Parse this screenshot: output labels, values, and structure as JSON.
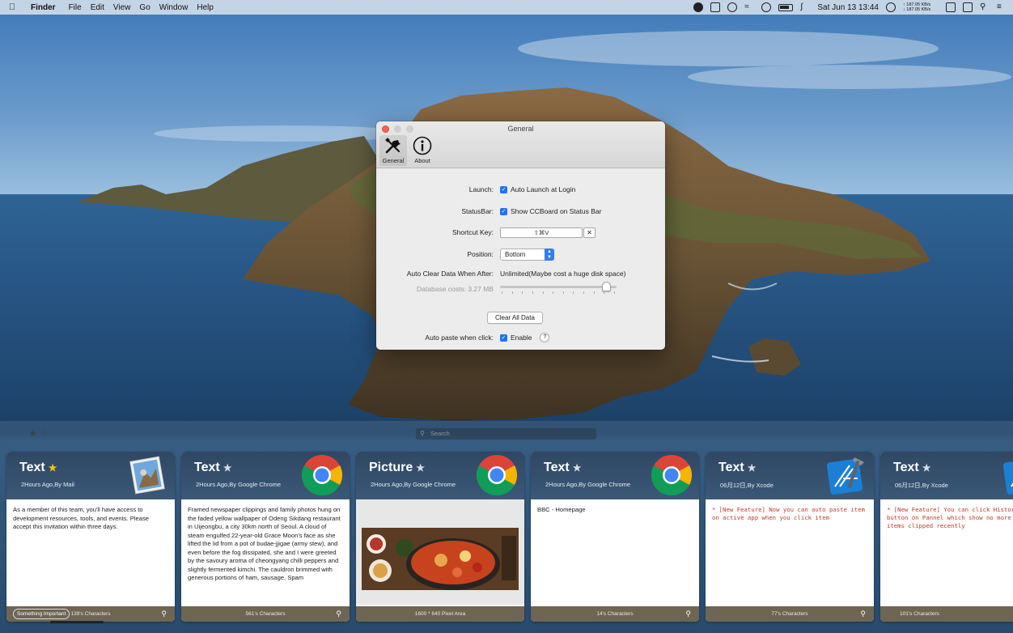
{
  "menubar": {
    "app": "Finder",
    "items": [
      "File",
      "Edit",
      "View",
      "Go",
      "Window",
      "Help"
    ],
    "clock": "Sat Jun 13  13:44",
    "netspeed_up": "↑ 187.05 KB/s",
    "netspeed_down": "↓ 187.05 KB/s"
  },
  "window": {
    "title": "General",
    "tabs": [
      {
        "label": "General",
        "icon": "tools-icon"
      },
      {
        "label": "About",
        "icon": "info-icon"
      }
    ],
    "launch": {
      "label": "Launch:",
      "value": "Auto Launch at Login",
      "checked": true
    },
    "statusbar": {
      "label": "StatusBar:",
      "value": "Show CCBoard on Status Bar",
      "checked": true
    },
    "shortcut": {
      "label": "Shortcut Key:",
      "value": "⇧⌘V",
      "clear": "✕"
    },
    "position": {
      "label": "Position:",
      "value": "Bottom"
    },
    "autoclear": {
      "label": "Auto Clear Data When After:",
      "value": "Unlimited(Maybe cost a huge disk space)",
      "level": 0.95
    },
    "database": {
      "label": "Database costs: 3.27 MB"
    },
    "clear_button": "Clear All Data",
    "autopaste": {
      "label": "Auto paste when click:",
      "value": "Enable",
      "checked": true,
      "help": "?"
    }
  },
  "panel": {
    "search_placeholder": "Search",
    "cards": [
      {
        "type": "Text",
        "starred": true,
        "meta": "2Hours Ago,By Mail",
        "app_icon": "mail-icon",
        "body": "As a member of this team, you'll have access to development resources, tools, and events. Please accept this invitation within three days.",
        "tag": "Something Important",
        "footer": "139's Characters"
      },
      {
        "type": "Text",
        "starred": false,
        "meta": "2Hours Ago,By Google Chrome",
        "app_icon": "chrome-icon",
        "body": "Framed newspaper clippings and family photos hung on the faded yellow wallpaper of Odeng Sikdang restaurant in Uijeongbu, a city 30km north of Seoul. A cloud of steam engulfed 22-year-old Grace Moon's face as she lifted the lid from a pot of budae-jjigae (army stew), and even before the fog dissipated, she and I were greeted by the savoury aroma of cheongyang chilli peppers and slightly fermented kimchi. The cauldron brimmed with generous portions of ham, sausage, Spam",
        "footer": "561's Characters"
      },
      {
        "type": "Picture",
        "starred": false,
        "meta": "2Hours Ago,By Google Chrome",
        "app_icon": "chrome-icon",
        "footer": "1600 * 640 Pixel Area"
      },
      {
        "type": "Text",
        "starred": false,
        "meta": "2Hours Ago,By Google Chrome",
        "app_icon": "chrome-icon",
        "body": "BBC - Homepage",
        "footer": "14's Characters"
      },
      {
        "type": "Text",
        "starred": false,
        "meta": "06月12日,By Xcode",
        "app_icon": "xcode-icon",
        "body": "* [New Feature] Now you can auto paste item on active app when you click item",
        "footer": "77's Characters"
      },
      {
        "type": "Text",
        "starred": false,
        "meta": "06月12日,By Xcode",
        "app_icon": "xcode-icon",
        "body": "* [New Feature] You can click History button on Pannel which show no more than 10 items clipped recently",
        "footer": "101's Characters"
      }
    ]
  },
  "colors": {
    "accent": "#1e74f5",
    "card_header": "#34506f",
    "card_footer": "#6e6553",
    "code_text": "#c0392b"
  }
}
